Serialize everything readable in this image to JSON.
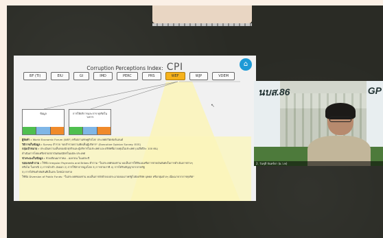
{
  "slide": {
    "title_lead": "Corruption Perceptions Index:",
    "title_big": "CPI",
    "home_icon": "home-icon",
    "index_buttons": [
      "BF (TI)",
      "EIU",
      "GI",
      "IMD",
      "PERC",
      "PRS",
      "WEF",
      "WJP",
      "VDEM"
    ],
    "active_index": "WEF",
    "boxes": [
      {
        "label": "ข้อมูล",
        "cells": [
          "",
          "",
          ""
        ],
        "cell_colors": [
          "#4fbf4f",
          "#7fb6e6",
          "#f08a2a"
        ]
      },
      {
        "label": "การให้บริการและการ ทุจริตในวงการ",
        "cells": [
          "",
          "",
          ""
        ],
        "cell_colors": [
          "#4fbf4f",
          "#7fb6e6",
          "#f08a2a"
        ]
      }
    ],
    "description_rows": [
      {
        "key": "ผู้จัดทำ :",
        "value": "World Economic Forum (WEF) หรือสภาเศรษฐกิจโลก ประเทศสวิตเซอร์แลนด์"
      },
      {
        "key": "วิธีการเก็บข้อมูล :",
        "value": "Survey สำรวจ \"ผลสำรวจความคิดเห็นผู้บริหาร\" (Executive Opinion Survey: EOS)"
      },
      {
        "key": "กลุ่มเป้าหมาย :",
        "value": "ประเมินความเห็นของนักธุรกิจและผู้บริหารในประเทศ และบริษัทที่มาลงทุนในประเทศ (เฉลี่ยปีละ 100 คน)"
      },
      {
        "key": "",
        "value": "ดำเนินการโดยเครือข่ายสถาบันพันธมิตรในแต่ละประเทศ"
      },
      {
        "key": "ช่วงระยะเก็บข้อมูล :",
        "value": "ช่วงเดือนมกราคม - เมษายน ในแต่ละปี"
      },
      {
        "key": "ขอบเขตคำถาม :",
        "value": "ใช้ข้อ Irregular Payments and Bribes คำถาม \"ในประเทศของท่าน พบเห็นการให้สินบนหรือการจ่ายเงินพิเศษในการดำเนินการต่างๆ"
      },
      {
        "key": "",
        "value": "หรือไม่ ในกรณี 1) การนำเข้า-ส่งออก 2) การใช้สาธารณูปโภค 3) การจ่ายภาษี 4) การได้รับสัญญาจากภาครัฐ"
      },
      {
        "key": "",
        "value": "5) การได้รับคำตัดสินที่เป็นประโยชน์จากศาล"
      },
      {
        "key": "",
        "value": "ใช้ข้อ Diversion of Public Funds: \"ในประเทศของท่าน พบเห็นการยักย้ายงบประมาณของภาครัฐไปยังบริษัท บุคคล หรือกลุ่มต่างๆ เนื่องมาจากการทุจริต\""
      }
    ]
  },
  "video": {
    "sign_left": "นบส.86",
    "sign_right": "GP",
    "name_label": "2. วันชุลี จันทร์ดา (ผ.ว.พ)"
  }
}
